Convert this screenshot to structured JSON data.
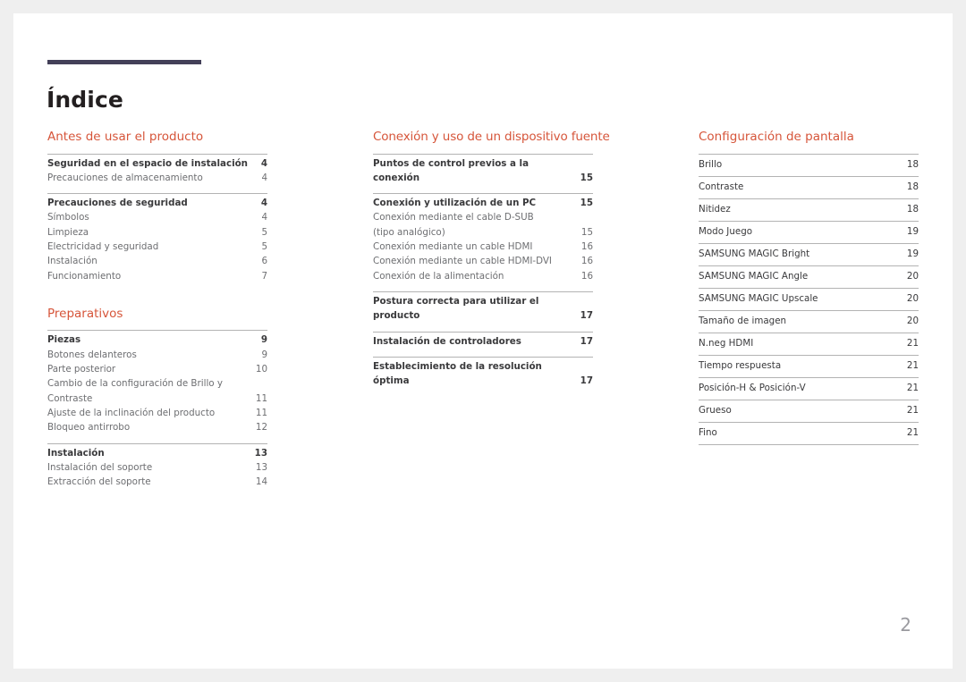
{
  "document": {
    "title": "Índice",
    "folio": "2",
    "accent_color": "#d6553a",
    "rule_color": "#434058"
  },
  "columns": [
    {
      "id": "column-left",
      "sections": [
        {
          "heading": "Antes de usar el producto",
          "groups": [
            {
              "entries": [
                {
                  "label": "Seguridad en el espacio de instalación",
                  "page": "4",
                  "level": "primary"
                },
                {
                  "label": "Precauciones de almacenamiento",
                  "page": "4",
                  "level": "secondary"
                }
              ]
            },
            {
              "entries": [
                {
                  "label": "Precauciones de seguridad",
                  "page": "4",
                  "level": "primary"
                },
                {
                  "label": "Símbolos",
                  "page": "4",
                  "level": "secondary"
                },
                {
                  "label": "Limpieza",
                  "page": "5",
                  "level": "secondary"
                },
                {
                  "label": "Electricidad y seguridad",
                  "page": "5",
                  "level": "secondary"
                },
                {
                  "label": "Instalación",
                  "page": "6",
                  "level": "secondary"
                },
                {
                  "label": "Funcionamiento",
                  "page": "7",
                  "level": "secondary"
                }
              ]
            }
          ]
        },
        {
          "heading": "Preparativos",
          "groups": [
            {
              "entries": [
                {
                  "label": "Piezas",
                  "page": "9",
                  "level": "primary"
                },
                {
                  "label": "Botones delanteros",
                  "page": "9",
                  "level": "secondary"
                },
                {
                  "label": "Parte posterior",
                  "page": "10",
                  "level": "secondary"
                },
                {
                  "label": "Cambio de la configuración de Brillo y Contraste",
                  "page": "11",
                  "level": "secondary"
                },
                {
                  "label": "Ajuste de la inclinación del producto",
                  "page": "11",
                  "level": "secondary"
                },
                {
                  "label": "Bloqueo antirrobo",
                  "page": "12",
                  "level": "secondary"
                }
              ]
            },
            {
              "entries": [
                {
                  "label": "Instalación",
                  "page": "13",
                  "level": "primary"
                },
                {
                  "label": "Instalación del soporte",
                  "page": "13",
                  "level": "secondary"
                },
                {
                  "label": "Extracción del soporte",
                  "page": "14",
                  "level": "secondary"
                }
              ]
            }
          ]
        }
      ]
    },
    {
      "id": "column-middle",
      "sections": [
        {
          "heading": "Conexión y uso de un dispositivo fuente",
          "groups": [
            {
              "entries": [
                {
                  "label": "Puntos de control previos a la conexión",
                  "page": "15",
                  "level": "primary"
                }
              ]
            },
            {
              "entries": [
                {
                  "label": "Conexión y utilización de un PC",
                  "page": "15",
                  "level": "primary"
                },
                {
                  "label": "Conexión mediante el cable D-SUB (tipo analógico)",
                  "page": "15",
                  "level": "secondary",
                  "wrap": true
                },
                {
                  "label": "Conexión mediante un cable HDMI",
                  "page": "16",
                  "level": "secondary"
                },
                {
                  "label": "Conexión mediante un cable HDMI-DVI",
                  "page": "16",
                  "level": "secondary"
                },
                {
                  "label": "Conexión de la alimentación",
                  "page": "16",
                  "level": "secondary"
                }
              ]
            },
            {
              "entries": [
                {
                  "label": "Postura correcta para utilizar el producto",
                  "page": "17",
                  "level": "primary"
                }
              ]
            },
            {
              "entries": [
                {
                  "label": "Instalación de controladores",
                  "page": "17",
                  "level": "primary"
                }
              ]
            },
            {
              "entries": [
                {
                  "label": "Establecimiento de la resolución óptima",
                  "page": "17",
                  "level": "primary"
                }
              ]
            }
          ]
        }
      ]
    },
    {
      "id": "column-right",
      "sections": [
        {
          "heading": "Configuración de pantalla",
          "banded": true,
          "entries": [
            {
              "label": "Brillo",
              "page": "18"
            },
            {
              "label": "Contraste",
              "page": "18"
            },
            {
              "label": "Nitidez",
              "page": "18"
            },
            {
              "label": "Modo Juego",
              "page": "19"
            },
            {
              "label": "SAMSUNG MAGIC Bright",
              "page": "19"
            },
            {
              "label": "SAMSUNG MAGIC Angle",
              "page": "20"
            },
            {
              "label": "SAMSUNG MAGIC Upscale",
              "page": "20"
            },
            {
              "label": "Tamaño de imagen",
              "page": "20"
            },
            {
              "label": "N.neg HDMI",
              "page": "21"
            },
            {
              "label": "Tiempo respuesta",
              "page": "21"
            },
            {
              "label": "Posición-H & Posición-V",
              "page": "21"
            },
            {
              "label": "Grueso",
              "page": "21"
            },
            {
              "label": "Fino",
              "page": "21"
            }
          ]
        }
      ]
    }
  ]
}
